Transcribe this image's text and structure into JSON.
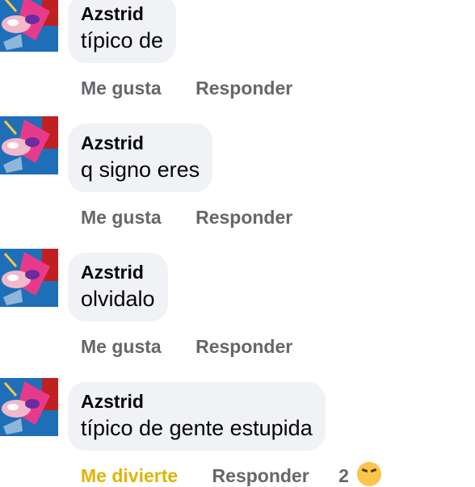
{
  "comments": [
    {
      "author": "Azstrid",
      "text": "típico de",
      "like": "Me gusta",
      "reply": "Responder"
    },
    {
      "author": "Azstrid",
      "text": "q signo eres",
      "like": "Me gusta",
      "reply": "Responder"
    },
    {
      "author": "Azstrid",
      "text": "olvidalo",
      "like": "Me gusta",
      "reply": "Responder"
    },
    {
      "author": "Azstrid",
      "text": "típico de gente estupida",
      "like": "Me divierte",
      "reply": "Responder",
      "reaction_count": "2",
      "reaction_icon": "laughing-emoji-icon"
    }
  ],
  "colors": {
    "bubble": "#f0f2f5",
    "action_text": "#65676b",
    "reaction_active": "#e0b400",
    "text": "#050505"
  }
}
